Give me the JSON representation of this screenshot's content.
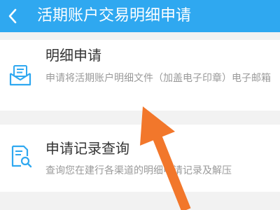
{
  "header": {
    "back_icon": "chevron-left-icon",
    "title": "活期账户交易明细申请"
  },
  "menu": [
    {
      "icon": "envelope-document-icon",
      "title": "明细申请",
      "description": "申请将活期账户明细文件（加盖电子印章）电子邮箱"
    },
    {
      "icon": "document-search-icon",
      "title": "申请记录查询",
      "description": "查询您在建行各渠道的明细申请记录及解压"
    }
  ],
  "annotation": {
    "arrow_icon": "pointer-arrow-icon",
    "arrow_color": "#f2772b"
  },
  "colors": {
    "accent": "#2fa8f0",
    "background": "#f2f2f2",
    "card": "#ffffff"
  }
}
